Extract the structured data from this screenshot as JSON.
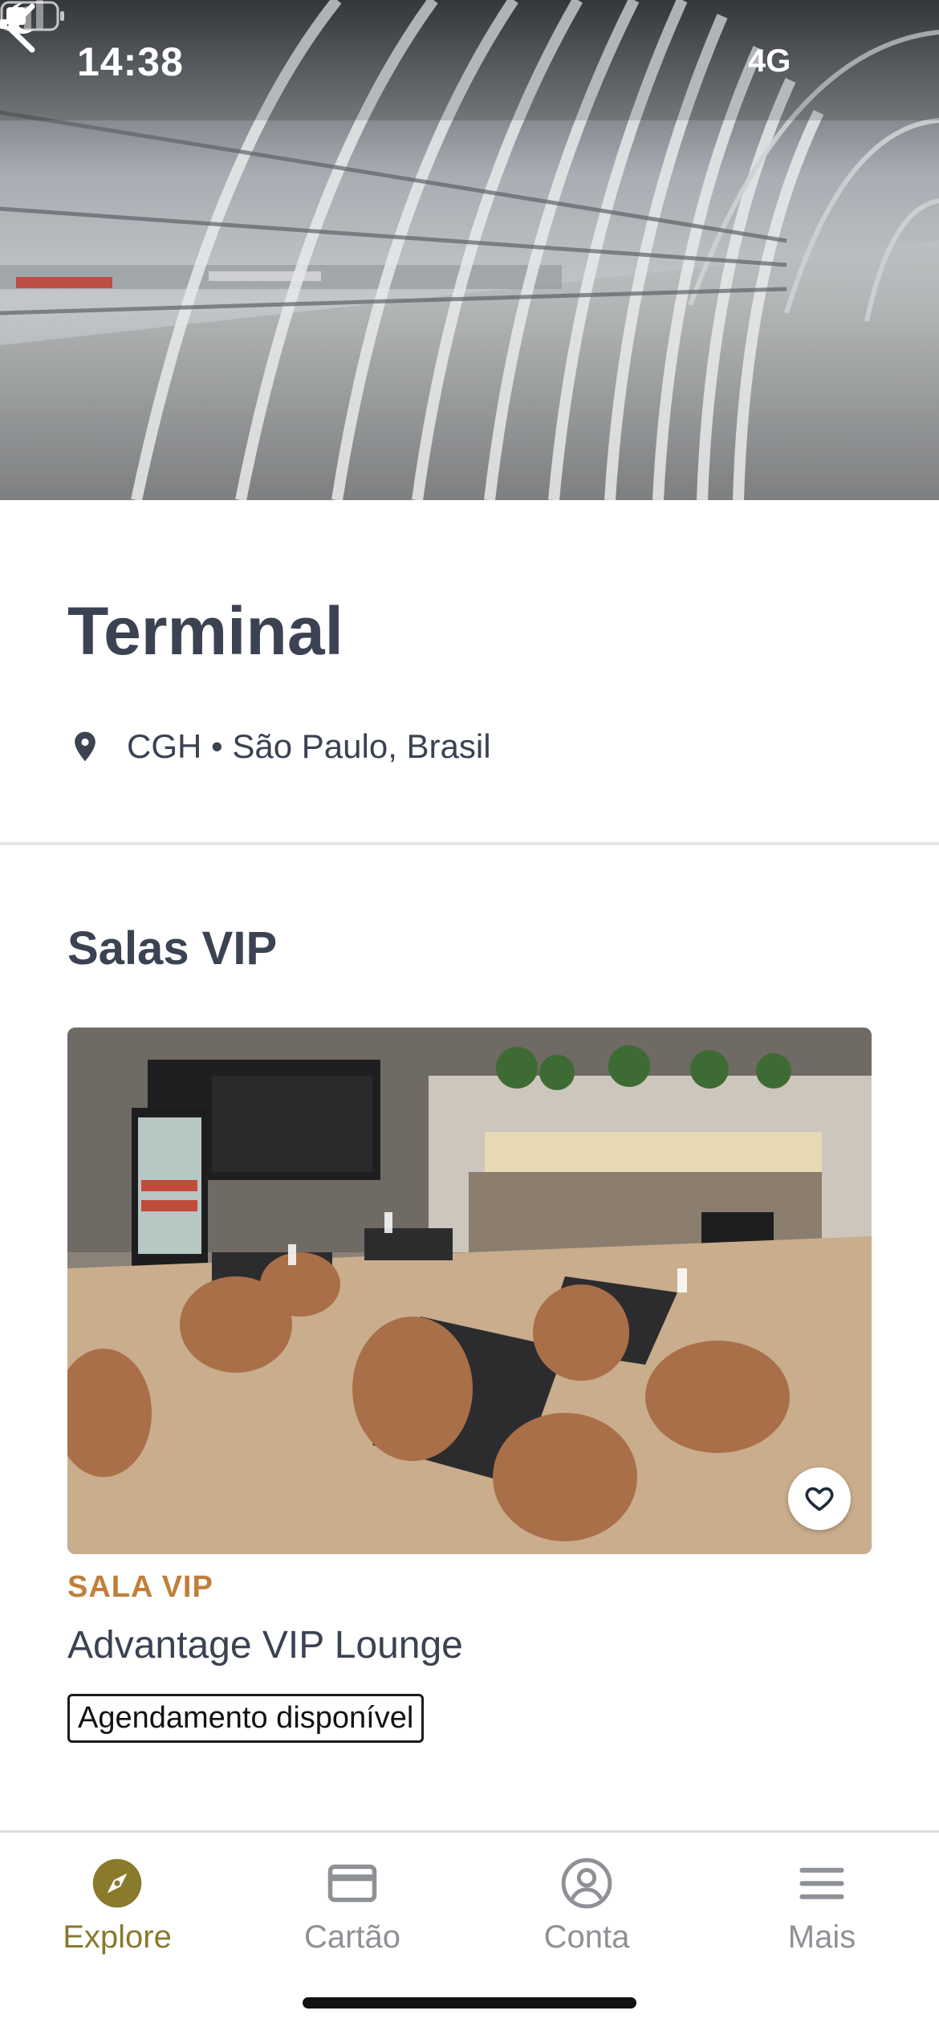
{
  "status_bar": {
    "time": "14:38",
    "network": "4G",
    "moon_icon": "moon-icon",
    "signal_icon": "signal-icon",
    "battery_icon": "battery-icon"
  },
  "header": {
    "back_icon": "chevron-left-icon"
  },
  "terminal": {
    "title": "Terminal",
    "location_icon": "map-pin-icon",
    "location": "CGH • São Paulo, Brasil"
  },
  "lounges": {
    "section_title": "Salas VIP",
    "items": [
      {
        "type": "SALA VIP",
        "name": "Advantage VIP Lounge",
        "badge": "Agendamento disponível",
        "favorite_icon": "heart-icon"
      }
    ]
  },
  "bottom_nav": {
    "items": [
      {
        "label": "Explore",
        "icon": "compass-icon",
        "active": true
      },
      {
        "label": "Cartão",
        "icon": "card-icon",
        "active": false
      },
      {
        "label": "Conta",
        "icon": "user-circle-icon",
        "active": false
      },
      {
        "label": "Mais",
        "icon": "menu-icon",
        "active": false
      }
    ]
  },
  "colors": {
    "accent": "#8a7a2c",
    "type_label": "#c07f3b",
    "text": "#3b4252",
    "inactive": "#8e9196"
  }
}
